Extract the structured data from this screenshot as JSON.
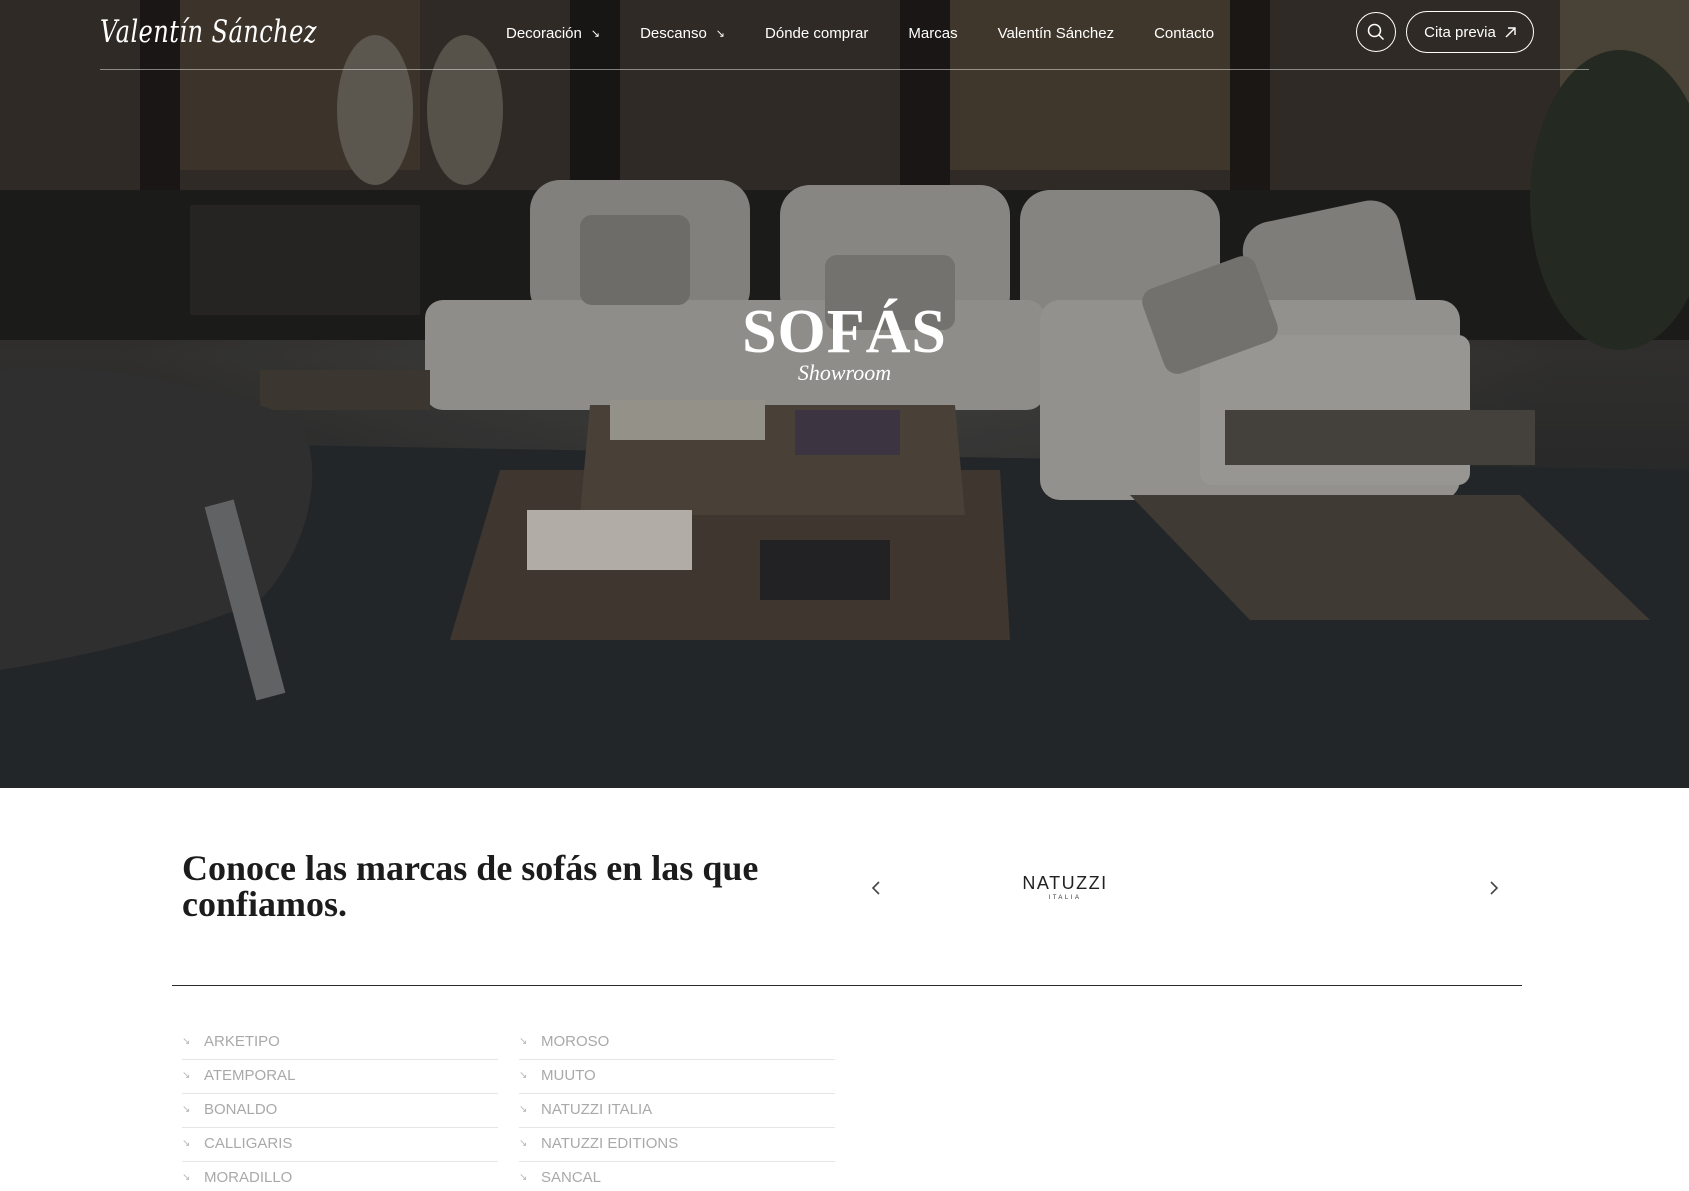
{
  "colors": {
    "white": "#ffffff",
    "ink": "#1c1c1c",
    "muted_link": "#a9a9a9",
    "divider": "#2a2a2a"
  },
  "header": {
    "logo": "Valentín Sánchez",
    "menu": [
      {
        "label": "Decoración",
        "icon": "arrow-down-right-icon"
      },
      {
        "label": "Descanso",
        "icon": "arrow-down-right-icon"
      },
      {
        "label": "Dónde comprar"
      },
      {
        "label": "Marcas"
      },
      {
        "label": "Valentín Sánchez"
      },
      {
        "label": "Contacto"
      }
    ],
    "search_icon": "search-icon",
    "cta_label": "Cita previa",
    "cta_icon": "arrow-up-right-icon"
  },
  "hero": {
    "title": "SOFÁS",
    "subtitle": "Showroom"
  },
  "brands_section": {
    "heading": "Conoce las marcas de sofás en las que confiamos.",
    "carousel": {
      "logo_main": "NATUZZI",
      "logo_sub": "ITALIA",
      "prev_icon": "chevron-left-icon",
      "next_icon": "chevron-right-icon"
    },
    "column_1": [
      "ARKETIPO",
      "ATEMPORAL",
      "BONALDO",
      "CALLIGARIS",
      "MORADILLO"
    ],
    "column_2": [
      "MOROSO",
      "MUUTO",
      "NATUZZI ITALIA",
      "NATUZZI EDITIONS",
      "SANCAL"
    ]
  }
}
